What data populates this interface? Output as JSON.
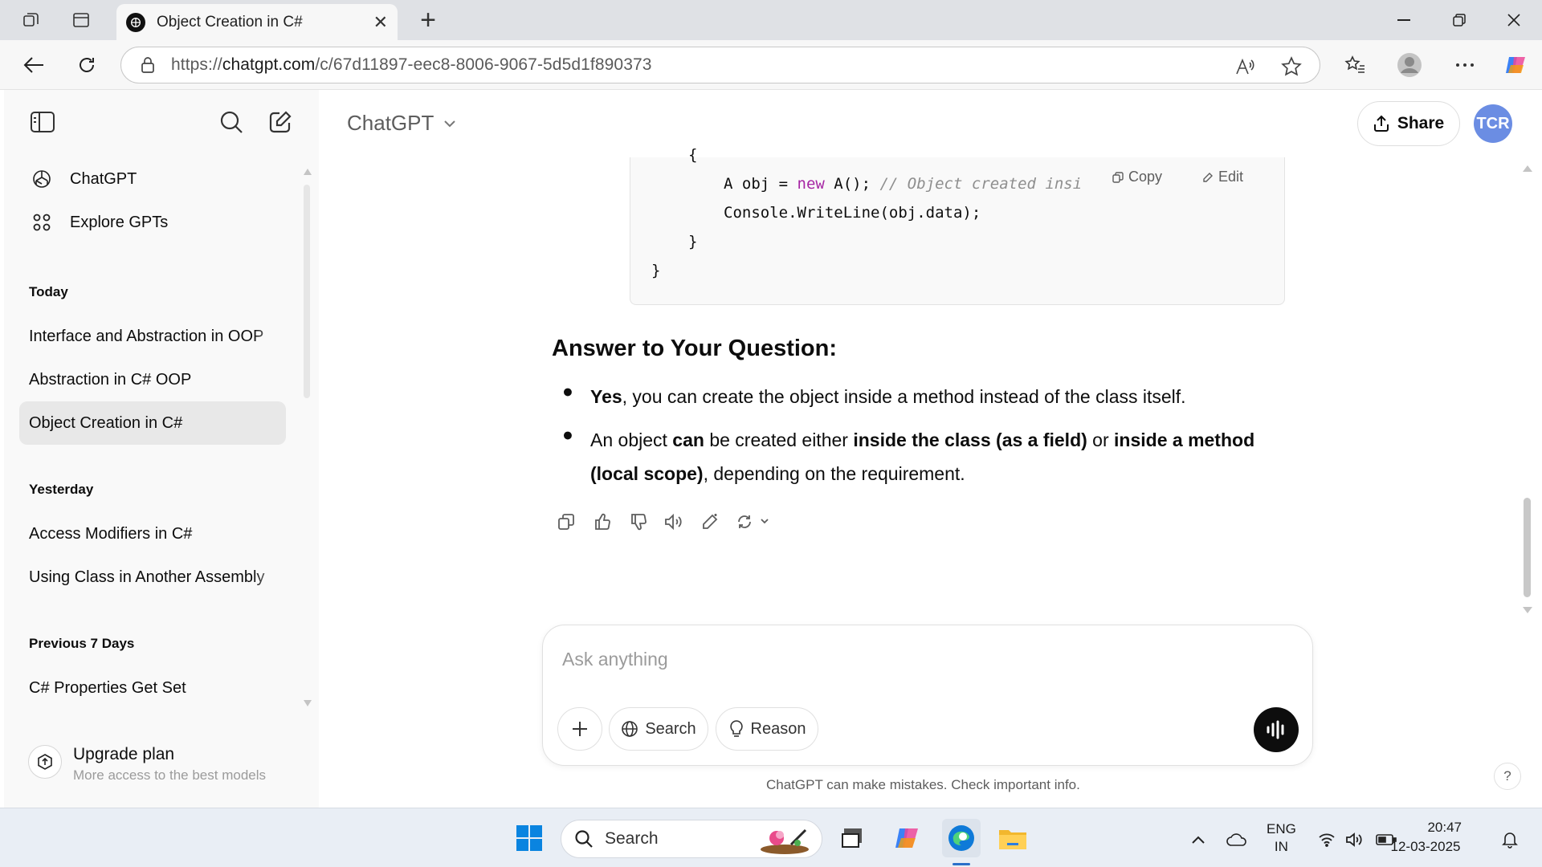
{
  "browser": {
    "tab_title": "Object Creation in C#",
    "url_prefix": "https://",
    "url_host": "chatgpt.com",
    "url_path": "/c/67d11897-eec8-8006-9067-5d5d1f890373"
  },
  "sidebar": {
    "nav": [
      {
        "label": "ChatGPT",
        "icon": "openai-logo-icon"
      },
      {
        "label": "Explore GPTs",
        "icon": "grid-icon"
      }
    ],
    "sections": [
      {
        "heading": "Today",
        "items": [
          "Interface and Abstraction in OOP",
          "Abstraction in C# OOP",
          "Object Creation in C#"
        ]
      },
      {
        "heading": "Yesterday",
        "items": [
          "Access Modifiers in C#",
          "Using Class in Another Assembly"
        ]
      },
      {
        "heading": "Previous 7 Days",
        "items": [
          "C# Properties Get Set"
        ]
      }
    ],
    "upgrade": {
      "title": "Upgrade plan",
      "subtitle": "More access to the best models"
    }
  },
  "header": {
    "model": "ChatGPT",
    "share_label": "Share",
    "avatar_initials": "TCR"
  },
  "code": {
    "brace_open": "{",
    "line1_pre": "A obj = ",
    "line1_kw": "new",
    "line1_post": " A(); ",
    "line1_comment": "// Object created insi",
    "line2": "Console.WriteLine(obj.data);",
    "brace_inner_close": "}",
    "brace_outer_close": "}",
    "copy_label": "Copy",
    "edit_label": "Edit"
  },
  "answer": {
    "heading": "Answer to Your Question:",
    "b1_bold": "Yes",
    "b1_text": ", you can create the object inside a method instead of the class itself.",
    "b2_t1": "An object ",
    "b2_b1": "can",
    "b2_t2": " be created either ",
    "b2_b2": "inside the class (as a field)",
    "b2_t3": " or ",
    "b2_b3": "inside a method (local scope)",
    "b2_t4": ", depending on the requirement."
  },
  "composer": {
    "placeholder": "Ask anything",
    "search_label": "Search",
    "reason_label": "Reason"
  },
  "disclaimer": "ChatGPT can make mistakes. Check important info.",
  "help": "?",
  "taskbar": {
    "search_label": "Search",
    "lang_top": "ENG",
    "lang_bottom": "IN",
    "time": "20:47",
    "date": "12-03-2025"
  }
}
